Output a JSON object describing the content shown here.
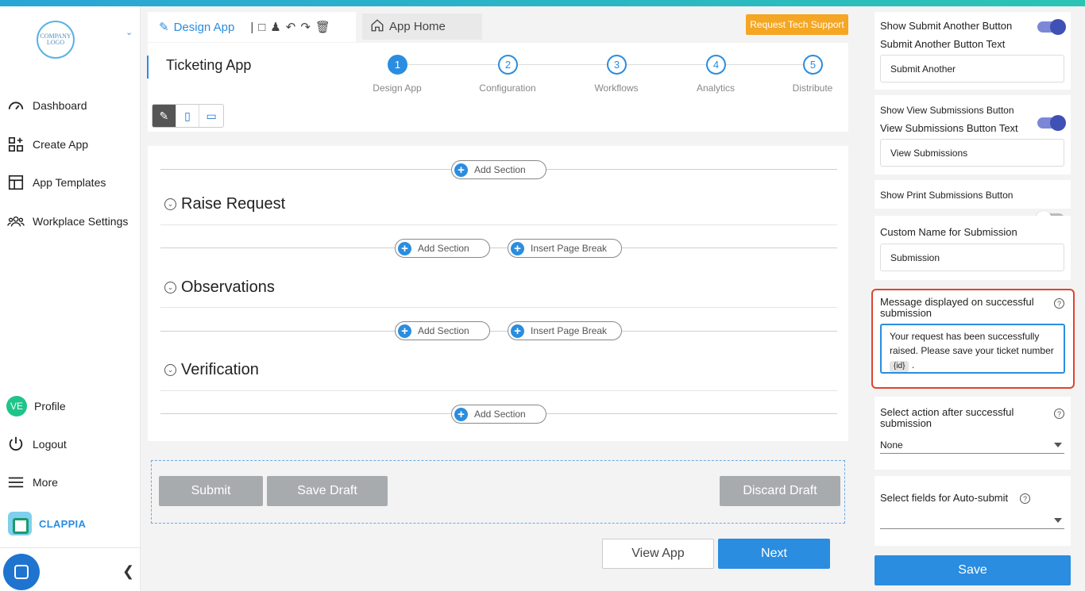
{
  "brand": {
    "logo_text": "COMPANY LOGO",
    "product": "CLAPPIA"
  },
  "sidebar": {
    "items": [
      {
        "label": "Dashboard",
        "icon": "speedometer-icon"
      },
      {
        "label": "Create App",
        "icon": "grid-plus-icon"
      },
      {
        "label": "App Templates",
        "icon": "template-icon"
      },
      {
        "label": "Workplace Settings",
        "icon": "users-icon"
      }
    ],
    "bottom": [
      {
        "label": "Profile",
        "avatar": "VE"
      },
      {
        "label": "Logout",
        "icon": "power-icon"
      },
      {
        "label": "More",
        "icon": "menu-icon"
      }
    ]
  },
  "toolbar": {
    "design_label": "Design App",
    "app_home": "App Home",
    "support": "Request Tech Support"
  },
  "app": {
    "title": "Ticketing App"
  },
  "steps": [
    {
      "num": "1",
      "label": "Design App",
      "active": true
    },
    {
      "num": "2",
      "label": "Configuration",
      "active": false
    },
    {
      "num": "3",
      "label": "Workflows",
      "active": false
    },
    {
      "num": "4",
      "label": "Analytics",
      "active": false
    },
    {
      "num": "5",
      "label": "Distribute",
      "active": false
    }
  ],
  "canvas": {
    "add_section": "Add Section",
    "insert_break": "Insert Page Break",
    "sections": [
      "Raise Request",
      "Observations",
      "Verification"
    ]
  },
  "actions": {
    "submit": "Submit",
    "save_draft": "Save Draft",
    "discard_draft": "Discard Draft",
    "view_app": "View App",
    "next": "Next"
  },
  "settings": {
    "show_submit_another": "Show Submit Another Button",
    "submit_another_text_label": "Submit Another Button Text",
    "submit_another_text": "Submit Another",
    "show_view_submissions": "Show View Submissions Button",
    "view_submissions_text_label": "View Submissions Button Text",
    "view_submissions_text": "View Submissions",
    "show_print": "Show Print Submissions Button",
    "custom_name_label": "Custom Name for Submission",
    "custom_name": "Submission",
    "message_label": "Message displayed on successful submission",
    "message_text": "Your request has been successfully raised. Please save your ticket number",
    "message_chip": "{id}",
    "message_tail": ".",
    "action_label": "Select action after successful submission",
    "action_value": "None",
    "autosubmit_label": "Select fields for Auto-submit",
    "autosubmit_value": "",
    "save": "Save"
  },
  "colors": {
    "accent": "#2a8de0",
    "support": "#f5a623",
    "highlight": "#e0442e",
    "toggle_on": "#3f51b5"
  }
}
